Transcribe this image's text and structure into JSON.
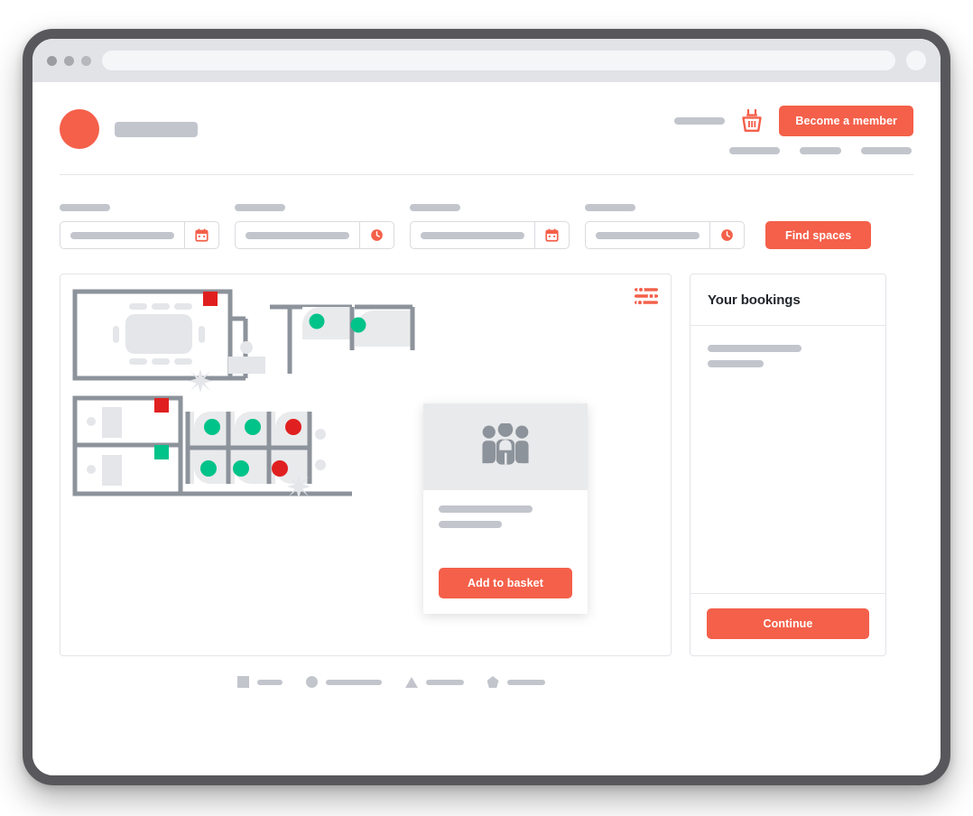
{
  "browser": {
    "traffic_lights": [
      "close-dot",
      "minimize-dot",
      "maximize-dot"
    ],
    "address_bar_value": "",
    "right_circle": "profile-circle"
  },
  "header": {
    "logo": "brand-logo-circle",
    "brand_name": "",
    "account_link": "",
    "basket_icon": "shopping-basket-icon",
    "member_button": "Become a member",
    "nav": [
      {
        "label": ""
      },
      {
        "label": ""
      },
      {
        "label": ""
      }
    ]
  },
  "search": {
    "fields": [
      {
        "label": "",
        "value": "",
        "icon": "calendar-icon"
      },
      {
        "label": "",
        "value": "",
        "icon": "clock-icon"
      },
      {
        "label": "",
        "value": "",
        "icon": "calendar-icon"
      },
      {
        "label": "",
        "value": "",
        "icon": "clock-icon"
      }
    ],
    "submit_label": "Find spaces"
  },
  "map": {
    "filter_icon": "filter-sliders-icon",
    "popup": {
      "image_icon": "people-group-icon",
      "title": "",
      "subtitle": "",
      "button_label": "Add to basket"
    },
    "markers": {
      "available_color": "#00c389",
      "occupied_color": "#e02020",
      "desk_pods": [
        {
          "row": 1,
          "col": 1,
          "status": "available"
        },
        {
          "row": 1,
          "col": 2,
          "status": "available"
        },
        {
          "row": 1,
          "col": 3,
          "status": "occupied"
        },
        {
          "row": 2,
          "col": 1,
          "status": "available"
        },
        {
          "row": 2,
          "col": 2,
          "status": "available"
        },
        {
          "row": 2,
          "col": 3,
          "status": "occupied"
        }
      ],
      "rooms": [
        {
          "name": "meeting-room-large",
          "status": "occupied"
        },
        {
          "name": "office-top-left",
          "status": "occupied"
        },
        {
          "name": "office-bottom-left",
          "status": "available"
        },
        {
          "name": "booth-top-a",
          "status": "available"
        },
        {
          "name": "booth-top-b",
          "status": "available"
        }
      ]
    }
  },
  "bookings": {
    "title": "Your bookings",
    "item_line_1": "",
    "item_line_2": "",
    "continue_label": "Continue"
  },
  "legend": {
    "items": [
      {
        "shape": "square",
        "label": ""
      },
      {
        "shape": "circle",
        "label": ""
      },
      {
        "shape": "triangle",
        "label": ""
      },
      {
        "shape": "pentagon",
        "label": ""
      }
    ]
  },
  "colors": {
    "accent": "#f4604a",
    "placeholder": "#c2c5cc",
    "wall": "#8d939b",
    "available": "#00c389",
    "occupied": "#e02020",
    "bezel": "#58585c"
  }
}
